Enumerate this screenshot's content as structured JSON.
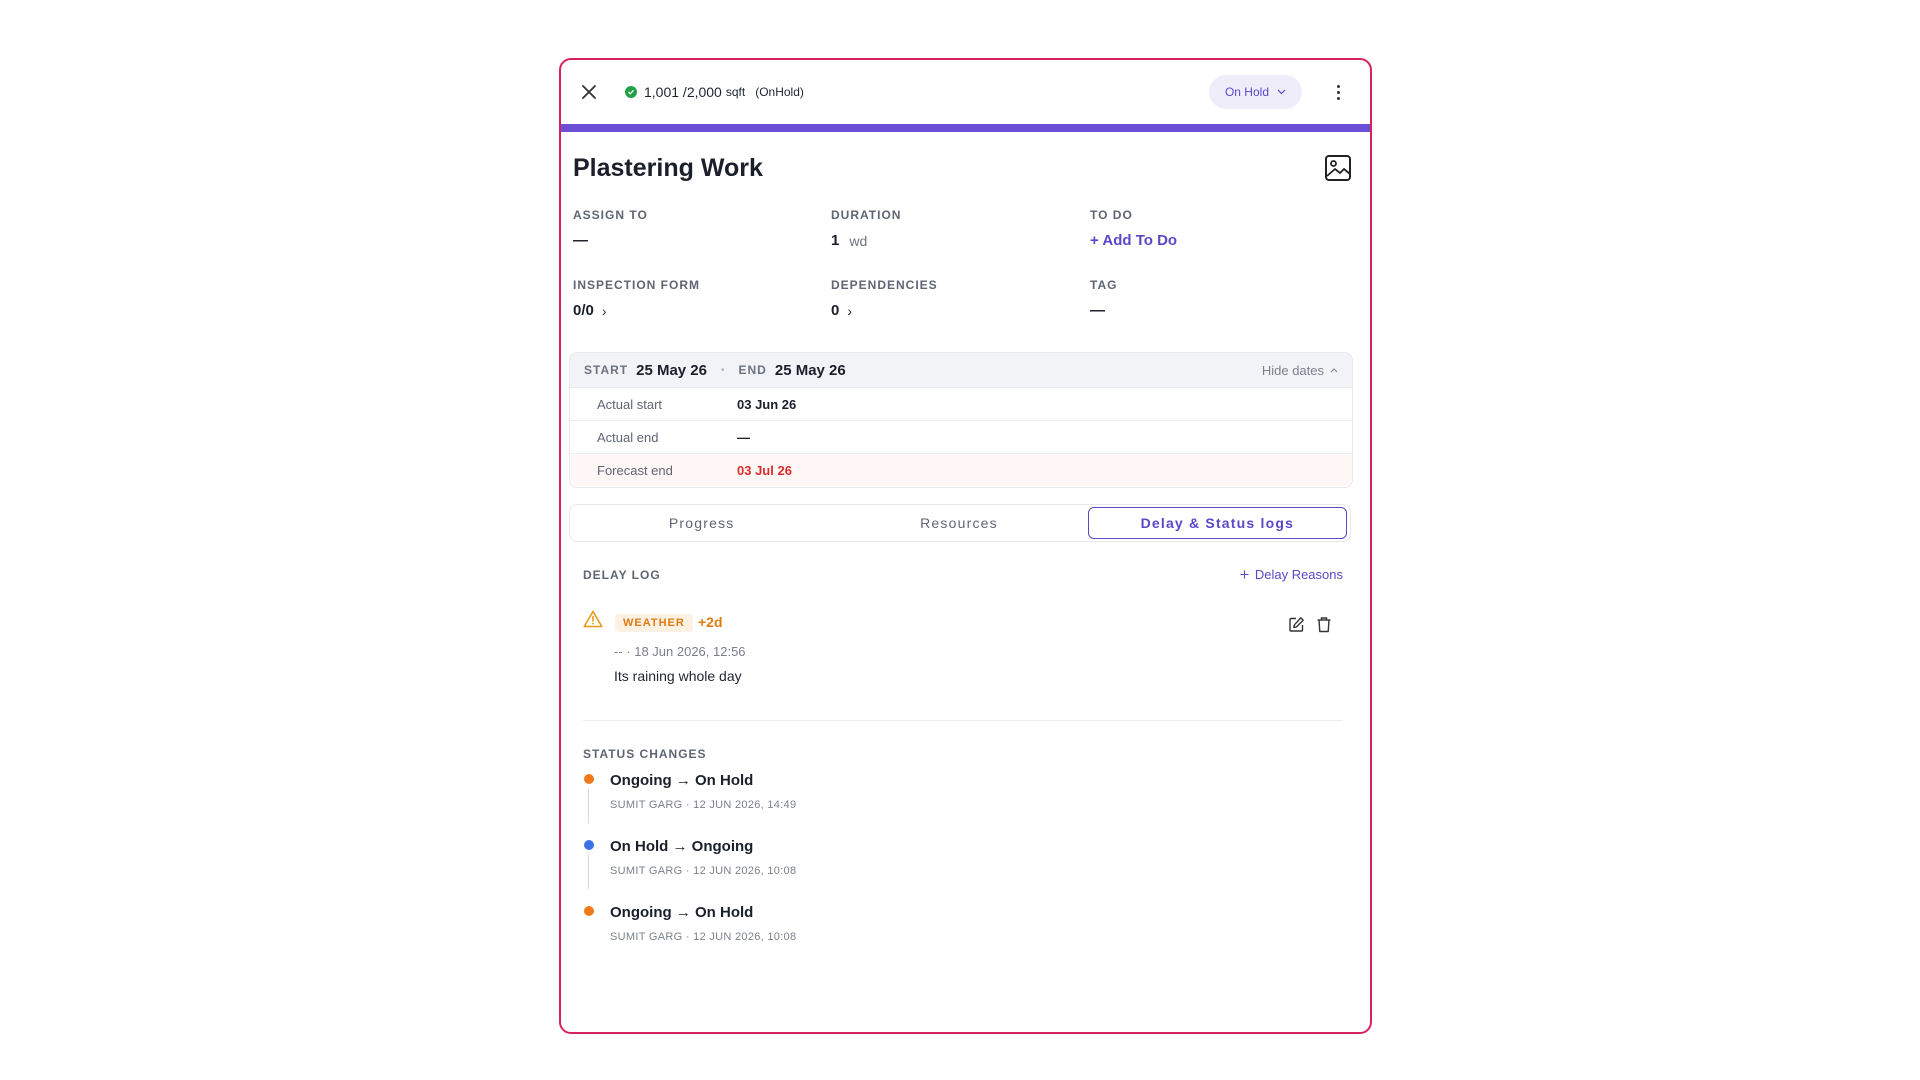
{
  "header": {
    "quantity": "1,001 /2,000",
    "unit": "sqft",
    "quantity_status": "(OnHold)",
    "status_selector": "On Hold",
    "accent_color": "#6a4fd6"
  },
  "task": {
    "title": "Plastering Work"
  },
  "fields": {
    "assign_to": {
      "label": "ASSIGN TO",
      "value": "—"
    },
    "duration": {
      "label": "DURATION",
      "value": "1",
      "unit": "wd"
    },
    "todo": {
      "label": "TO DO",
      "action": "+ Add To Do"
    },
    "inspection_form": {
      "label": "INSPECTION FORM",
      "value": "0/0"
    },
    "dependencies": {
      "label": "DEPENDENCIES",
      "value": "0"
    },
    "tag": {
      "label": "TAG",
      "value": "—"
    }
  },
  "dates": {
    "start_label": "START",
    "start_value": "25 May 26",
    "end_label": "END",
    "end_value": "25 May 26",
    "toggle_label": "Hide dates",
    "rows": [
      {
        "label": "Actual start",
        "value": "03 Jun 26"
      },
      {
        "label": "Actual end",
        "value": "—"
      },
      {
        "label": "Forecast end",
        "value": "03 Jul 26"
      }
    ]
  },
  "tabs": [
    {
      "label": "Progress",
      "active": false
    },
    {
      "label": "Resources",
      "active": false
    },
    {
      "label": "Delay & Status logs",
      "active": true
    }
  ],
  "delay_log": {
    "heading": "DELAY LOG",
    "add_label": "Delay Reasons",
    "items": [
      {
        "reason": "WEATHER",
        "days": "+2d",
        "meta": "-- · 18 Jun 2026, 12:56",
        "note": "Its raining whole day"
      }
    ]
  },
  "status_changes": {
    "heading": "STATUS CHANGES",
    "items": [
      {
        "title": "Ongoing → On Hold",
        "meta": "SUMIT GARG · 12 JUN 2026, 14:49",
        "dot_color": "#f07a1a"
      },
      {
        "title": "On Hold → Ongoing",
        "meta": "SUMIT GARG · 12 JUN 2026, 10:08",
        "dot_color": "#3b73e6"
      },
      {
        "title": "Ongoing → On Hold",
        "meta": "SUMIT GARG · 12 JUN 2026, 10:08",
        "dot_color": "#f07a1a"
      }
    ]
  },
  "icons": {
    "close": "close-icon",
    "status": "check-circle-icon",
    "dropdown": "chevron-down-icon",
    "more": "more-vertical-icon",
    "image": "image-icon",
    "warning": "warning-icon",
    "edit": "edit-icon",
    "delete": "trash-icon"
  }
}
